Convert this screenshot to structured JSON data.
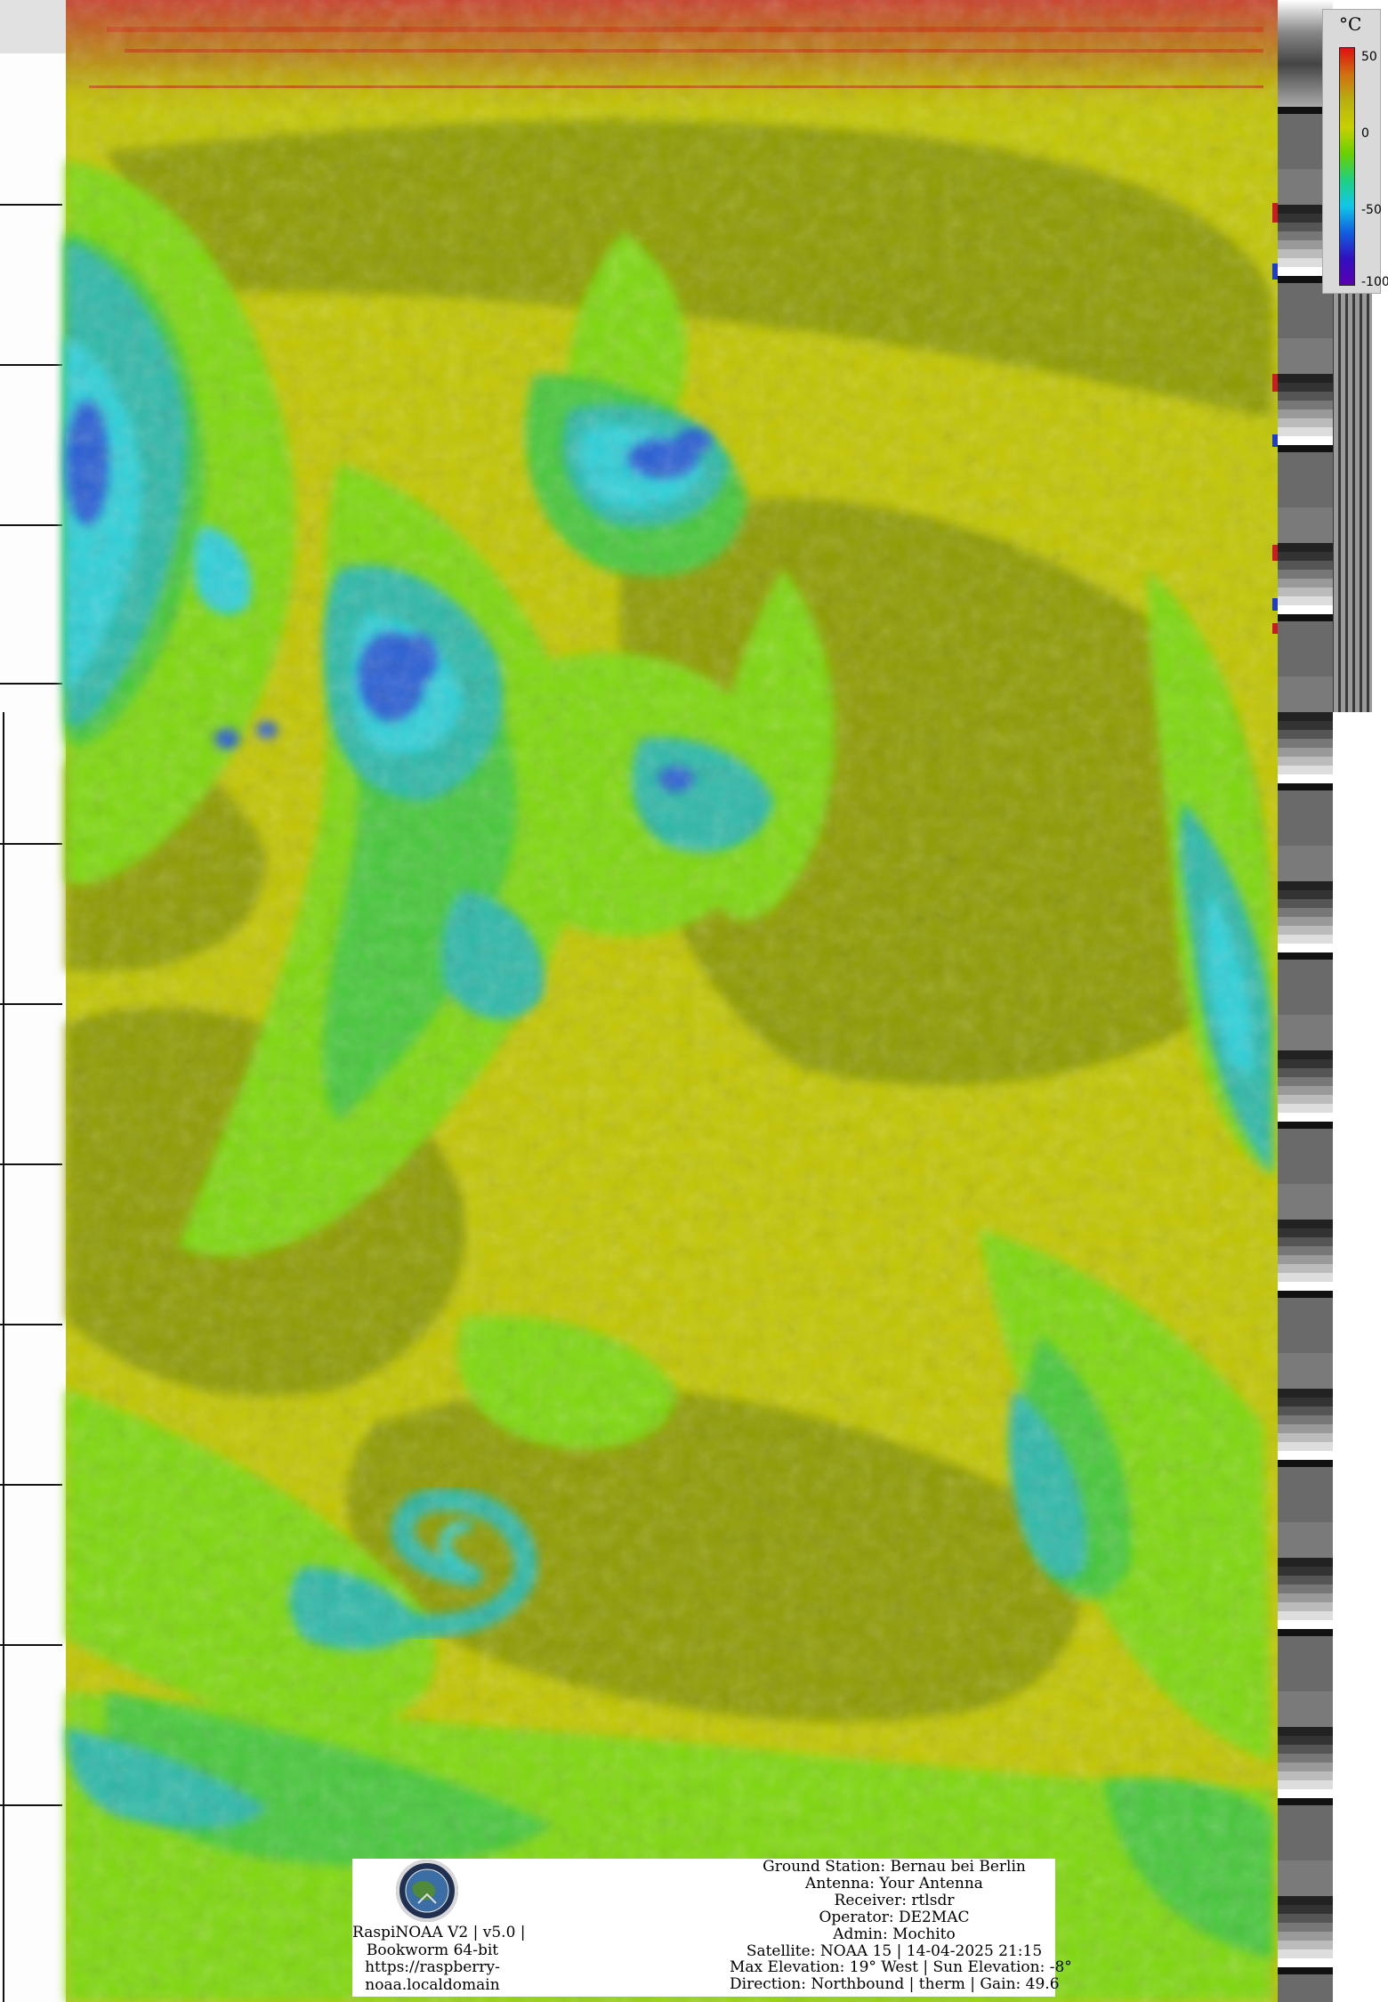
{
  "legend": {
    "unit": "°C",
    "ticks": [
      "50",
      "0",
      "-50",
      "-100"
    ],
    "gradient_colors": [
      "#e01010",
      "#d07010",
      "#b8b010",
      "#c8d000",
      "#6ad000",
      "#20d080",
      "#10c8e8",
      "#1060e0",
      "#3010c0",
      "#5a00b0"
    ]
  },
  "imagery": {
    "palette": {
      "warm_yellow": "#c9cf00",
      "olive": "#8f9c00",
      "lime": "#7fd80e",
      "green": "#46c83a",
      "teal": "#2fb9a8",
      "cyan": "#2fd0d8",
      "blue": "#2b5fd4",
      "red_edge": "#c83a10",
      "gray_strip": "#777777"
    }
  },
  "footer": {
    "logo_icon": "raspinoaa-logo-icon",
    "credits": [
      "RaspiNOAA V2 | v5.0 |",
      "Bookworm 64-bit",
      "https://raspberry-",
      "noaa.localdomain"
    ],
    "station_lines": [
      "Ground Station: Bernau bei Berlin",
      "Antenna: Your Antenna",
      "Receiver: rtlsdr",
      "Operator: DE2MAC",
      "Admin: Mochito",
      "Satellite: NOAA 15 | 14-04-2025 21:15",
      "Max Elevation: 19° West | Sun Elevation: -8°",
      "Direction: Northbound | therm | Gain: 49.6"
    ]
  }
}
